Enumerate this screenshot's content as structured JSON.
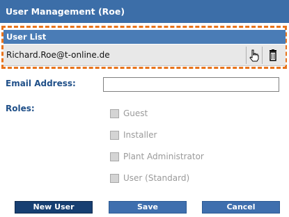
{
  "header": {
    "title": "User Management (Roe)"
  },
  "user_list": {
    "title": "User List",
    "rows": [
      {
        "email": "Richard.Roe@t-online.de"
      }
    ]
  },
  "form": {
    "email_label": "Email Address:",
    "email_value": "",
    "roles_label": "Roles:",
    "roles": [
      {
        "label": "Guest",
        "checked": false
      },
      {
        "label": "Installer",
        "checked": false
      },
      {
        "label": "Plant Administrator",
        "checked": false
      },
      {
        "label": "User (Standard)",
        "checked": false
      }
    ]
  },
  "buttons": {
    "new_user": "New User",
    "save": "Save",
    "cancel": "Cancel"
  },
  "colors": {
    "header_bg": "#3c6ea8",
    "list_header_bg": "#4a7cb6",
    "highlight_border": "#e8731c",
    "label_text": "#1f4f88"
  },
  "icons": {
    "select_icon": "hand-pointer-icon",
    "delete_icon": "trash-icon"
  }
}
